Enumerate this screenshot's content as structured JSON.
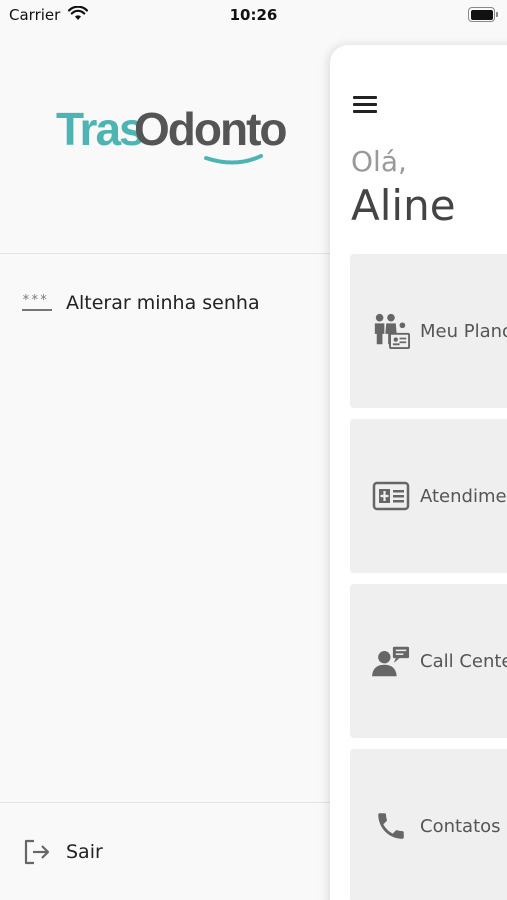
{
  "status_bar": {
    "carrier": "Carrier",
    "time": "10:26"
  },
  "drawer": {
    "logo": {
      "part1": "Tras",
      "part2": "Odonto",
      "color_primary": "#4db3b3",
      "color_secondary": "#555555"
    },
    "items": [
      {
        "label": "Alterar minha senha",
        "icon": "password-icon"
      }
    ],
    "footer": {
      "label": "Sair",
      "icon": "logout-icon"
    }
  },
  "main": {
    "greeting": "Olá,",
    "username": "Aline",
    "cards": [
      {
        "label": "Meu Plano",
        "icon": "family-card-icon"
      },
      {
        "label": "Atendimento",
        "icon": "medical-card-icon"
      },
      {
        "label": "Call Center",
        "icon": "support-chat-icon"
      },
      {
        "label": "Contatos",
        "icon": "phone-icon"
      }
    ]
  }
}
